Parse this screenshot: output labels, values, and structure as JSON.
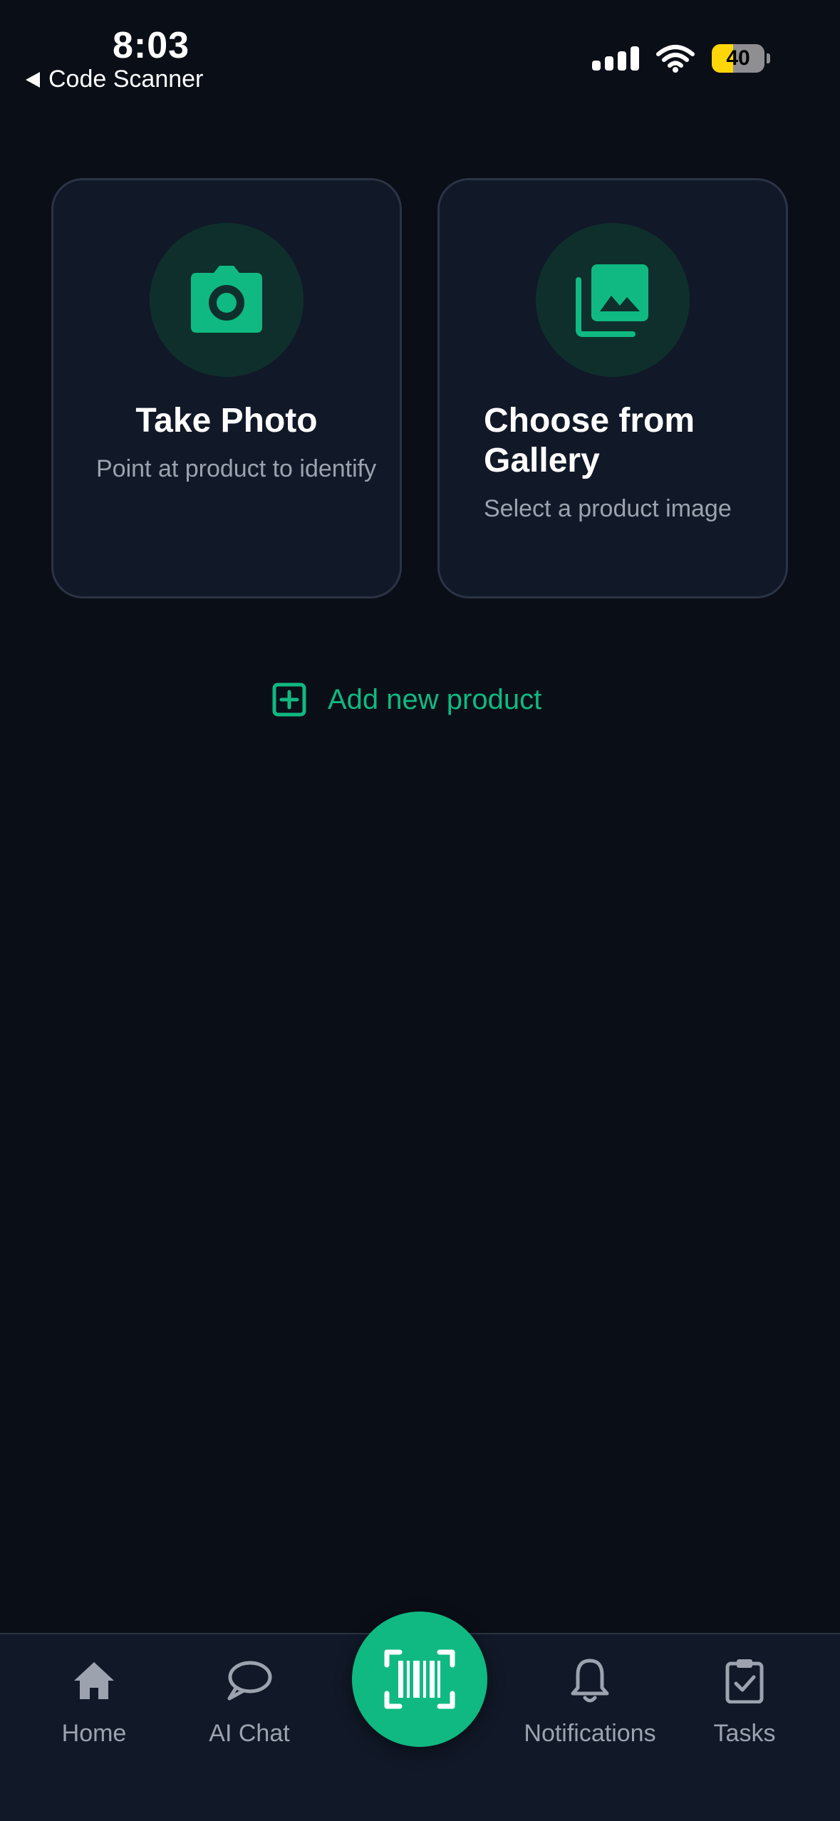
{
  "status_bar": {
    "time": "8:03",
    "back_label": "Code Scanner",
    "battery_level": "40",
    "icons": [
      "back-triangle-icon",
      "signal-icon",
      "wifi-icon",
      "battery-icon"
    ]
  },
  "cards": [
    {
      "title": "Take Photo",
      "subtitle": "Point at product to identify",
      "icon": "camera-icon"
    },
    {
      "title": "Choose from Gallery",
      "subtitle": "Select a product image",
      "icon": "gallery-icon"
    }
  ],
  "add_product": {
    "label": "Add new product",
    "icon": "plus-square-icon"
  },
  "bottom_nav": {
    "items": [
      {
        "label": "Home",
        "icon": "home-icon"
      },
      {
        "label": "AI Chat",
        "icon": "chat-bubble-icon"
      },
      {
        "label": "Notifications",
        "icon": "bell-icon"
      },
      {
        "label": "Tasks",
        "icon": "clipboard-check-icon"
      }
    ],
    "scan_icon": "barcode-scan-icon"
  },
  "colors": {
    "background": "#0a0e17",
    "card_background": "#111827",
    "card_border": "#2b3444",
    "accent": "#10b981",
    "icon_circle": "#0f2f2c",
    "muted_text": "#9ca3af",
    "battery_fill": "#ffd60a"
  }
}
